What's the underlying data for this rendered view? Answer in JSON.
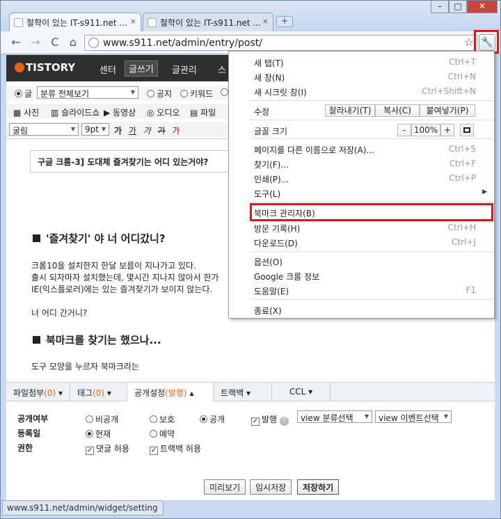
{
  "window": {
    "tabs": [
      {
        "title": "철학이 있는 IT-s911.net ...",
        "close": "×"
      },
      {
        "title": "철학이 있는 IT-s911.net ...",
        "close": "×"
      }
    ],
    "new_tab": "+",
    "controls": {
      "minimize": "–",
      "maximize": "□",
      "close": "✕"
    }
  },
  "toolbar": {
    "url": "www.s911.net/admin/entry/post/",
    "back": "←",
    "forward": "→",
    "reload": "C",
    "home": "⌂",
    "star": "☆",
    "wrench": "🔧"
  },
  "tistory": {
    "logo": "TISTORY",
    "nav": [
      "센터",
      "글쓰기",
      "글관리",
      "스"
    ]
  },
  "post_options": {
    "type_glo": "글",
    "category": "분류 전체보기",
    "notice": "공지",
    "keyword": "키워드"
  },
  "attach_bar": [
    "사진",
    "슬라이드쇼",
    "동영상",
    "오디오",
    "파일"
  ],
  "format_bar": {
    "font": "굴림",
    "size": "9pt",
    "buttons": [
      "가",
      "가",
      "가",
      "가",
      "가"
    ]
  },
  "post": {
    "title_box": "구글 크롬-3] 도대체 즐겨찾기는 어디 있는거야?",
    "heading1": "'즐겨찾기' 야 너 어디갔니?",
    "para1": "크롬10을 설치한지 한달 보름이 지나가고 있다.",
    "para2": "출시 되자마자 설치했는데, 몇시간 지나지 않아서 한가",
    "para3": "IE(익스플로러)에는 있는 즐겨찾기가 보이지 않는다.",
    "para4": "너 어디 간거니?",
    "heading2": "북마크를 찾기는 했으나...",
    "para5": "도구 모양을 누르자 북마크라는"
  },
  "bottom_tabs": [
    {
      "label": "파일첨부",
      "count": "(0)"
    },
    {
      "label": "태그",
      "count": "(0)"
    },
    {
      "label": "공개설정",
      "count": "(발행)"
    },
    {
      "label": "트랙백",
      "count": ""
    },
    {
      "label": "CCL",
      "count": ""
    }
  ],
  "settings": {
    "visibility_label": "공개여부",
    "private": "비공개",
    "protected": "보호",
    "public": "공개",
    "publish": "발행",
    "view_category": "view 분류선택",
    "view_event": "view 이벤트선택",
    "date_label": "등록일",
    "now": "현재",
    "reserve": "예약",
    "perm_label": "권한",
    "allow_comments": "댓글 허용",
    "allow_trackback": "트랙백 허용"
  },
  "actions": {
    "preview": "미리보기",
    "temp_save": "임시저장",
    "save": "저장하기"
  },
  "status_url": "www.s911.net/admin/widget/setting",
  "menu": {
    "new_tab": "새 탭(T)",
    "new_tab_sc": "Ctrl+T",
    "new_window": "새 창(N)",
    "new_window_sc": "Ctrl+N",
    "incognito": "새 시크릿 창(I)",
    "incognito_sc": "Ctrl+Shift+N",
    "edit": "수정",
    "cut": "잘라내기(T)",
    "copy": "복사(C)",
    "paste": "붙여넣기(P)",
    "font_size": "글꼴 크기",
    "zoom_out": "-",
    "zoom": "100%",
    "zoom_in": "+",
    "save_as": "페이지를 다른 이름으로 저장(A)...",
    "save_as_sc": "Ctrl+S",
    "find": "찾기(F)...",
    "find_sc": "Ctrl+F",
    "print": "인쇄(P)...",
    "print_sc": "Ctrl+P",
    "tools": "도구(L)",
    "tools_arrow": "▶",
    "bookmark_manager": "북마크 관리자(B)",
    "history": "방문 기록(H)",
    "history_sc": "Ctrl+H",
    "downloads": "다운로드(D)",
    "downloads_sc": "Ctrl+J",
    "options": "옵션(O)",
    "about": "Google 크롬 정보",
    "help": "도움말(E)",
    "help_sc": "F1",
    "exit": "종료(X)"
  },
  "colors": {
    "highlight": "#e0141e",
    "accent": "#e8611c"
  }
}
